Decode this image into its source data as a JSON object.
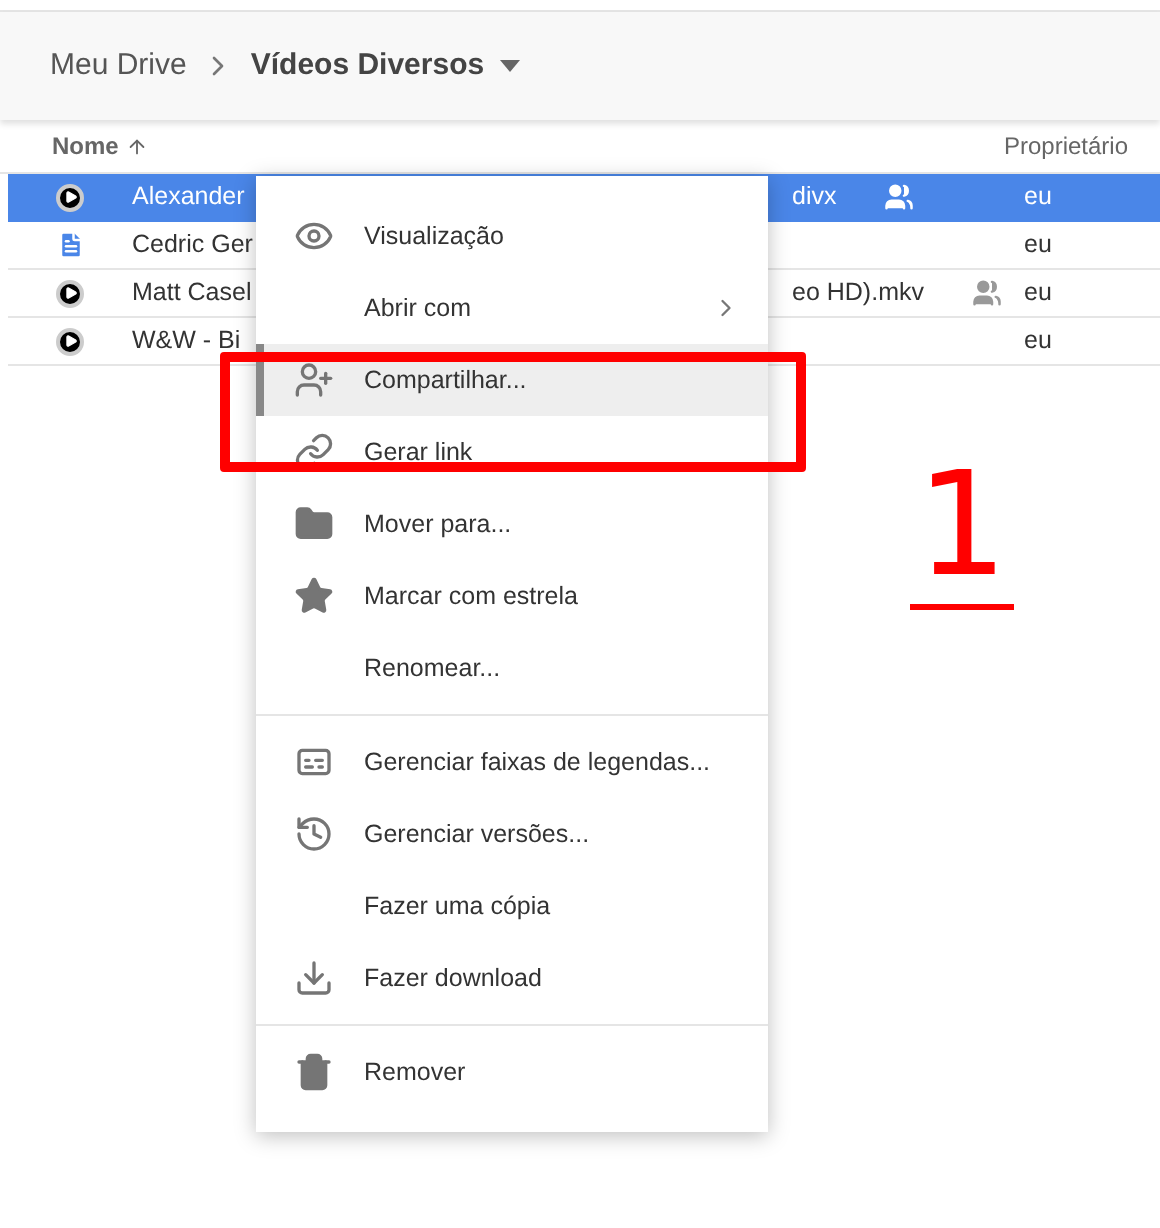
{
  "breadcrumb": {
    "parent": "Meu Drive",
    "current": "Vídeos Diversos"
  },
  "columns": {
    "name": {
      "label": "Nome",
      "sorted": true
    },
    "owner": {
      "label": "Proprietário"
    }
  },
  "rows": [
    {
      "kind": "video",
      "name": "Alexander",
      "name_tail": "divx",
      "shared": true,
      "owner": "eu",
      "selected": true
    },
    {
      "kind": "doc",
      "name": "Cedric Ger",
      "shared": false,
      "owner": "eu",
      "selected": false
    },
    {
      "kind": "video",
      "name": "Matt Casel",
      "name_tail": "eo HD).mkv",
      "shared": true,
      "owner": "eu",
      "selected": false
    },
    {
      "kind": "video",
      "name": "W&W - Bi",
      "shared": false,
      "owner": "eu",
      "selected": false
    }
  ],
  "menu": {
    "sections": [
      [
        {
          "kind": "view",
          "label": "Visualização",
          "selected": false
        },
        {
          "kind": "open",
          "label": "Abrir com",
          "submenu": true,
          "selected": false
        },
        {
          "kind": "share",
          "label": "Compartilhar...",
          "selected": true
        },
        {
          "kind": "link",
          "label": "Gerar link",
          "selected": false
        },
        {
          "kind": "move",
          "label": "Mover para...",
          "selected": false
        },
        {
          "kind": "star",
          "label": "Marcar com estrela",
          "selected": false
        },
        {
          "kind": "rename",
          "label": "Renomear...",
          "selected": false
        }
      ],
      [
        {
          "kind": "captions",
          "label": "Gerenciar faixas de legendas...",
          "selected": false
        },
        {
          "kind": "versions",
          "label": "Gerenciar versões...",
          "selected": false
        },
        {
          "kind": "copy",
          "label": "Fazer uma cópia",
          "selected": false
        },
        {
          "kind": "download",
          "label": "Fazer download",
          "selected": false
        }
      ],
      [
        {
          "kind": "remove",
          "label": "Remover",
          "selected": false
        }
      ]
    ]
  },
  "annotation": {
    "highlight": true,
    "mark": "1"
  }
}
